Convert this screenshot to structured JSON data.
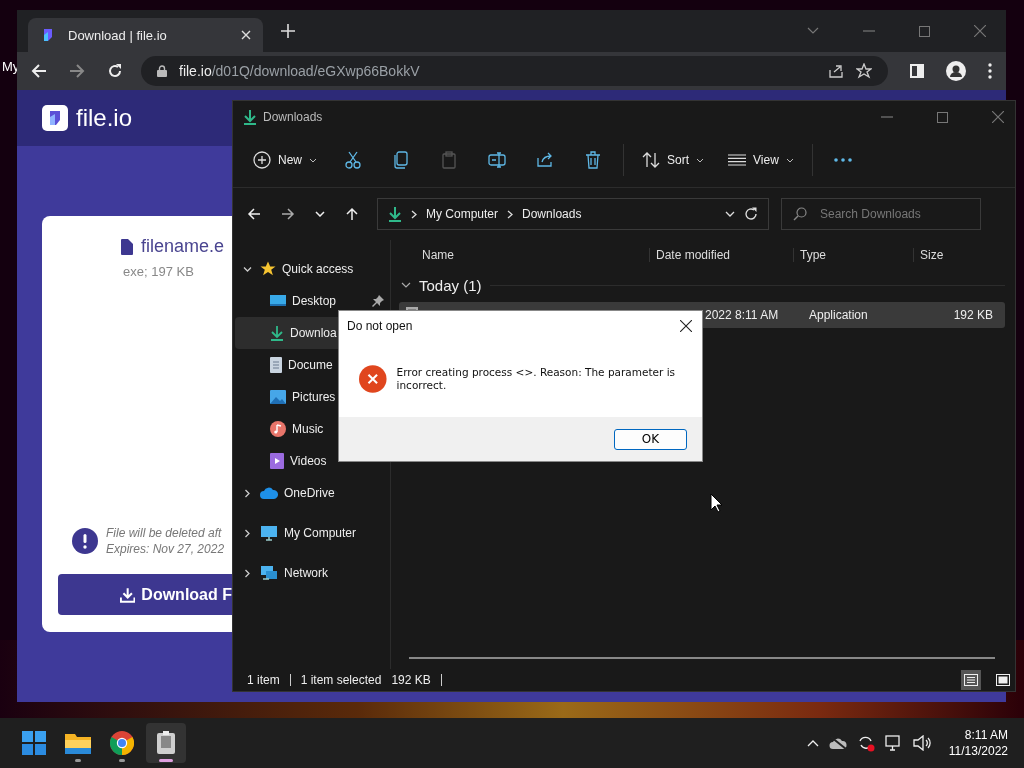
{
  "desktop": {
    "icon_label": "My"
  },
  "browser": {
    "tab": {
      "title": "Download | file.io",
      "selected": true
    },
    "url_host": "file.io",
    "url_path": "/d01Q/download/eGXwp66BokkV",
    "page": {
      "brand": "file.io",
      "file_name": "filename.e",
      "file_meta": "exe; 197 KB",
      "notice": "File will be deleted aft",
      "expires": "Expires: Nov 27, 2022",
      "download_button": "Download F"
    }
  },
  "explorer": {
    "title": "Downloads",
    "toolbar": [
      {
        "kind": "new",
        "label": "New",
        "disabled": false
      },
      {
        "kind": "cut",
        "disabled": false
      },
      {
        "kind": "copy",
        "disabled": false
      },
      {
        "kind": "paste",
        "disabled": true
      },
      {
        "kind": "rename",
        "disabled": false
      },
      {
        "kind": "share",
        "disabled": false
      },
      {
        "kind": "delete",
        "disabled": false
      },
      {
        "kind": "sort",
        "label": "Sort",
        "disabled": false
      },
      {
        "kind": "view",
        "label": "View",
        "disabled": false
      },
      {
        "kind": "more",
        "disabled": false
      }
    ],
    "breadcrumb": [
      "My Computer",
      "Downloads"
    ],
    "search": {
      "placeholder": "Search Downloads"
    },
    "sidebar": [
      {
        "kind": "star",
        "label": "Quick access",
        "expanded": true,
        "selected": false,
        "children": [
          {
            "kind": "desktop",
            "label": "Desktop",
            "pinned": true,
            "selected": false
          },
          {
            "kind": "download",
            "label": "Downloa",
            "pinned": false,
            "selected": true
          },
          {
            "kind": "document",
            "label": "Docume",
            "pinned": false,
            "selected": false
          },
          {
            "kind": "pictures",
            "label": "Pictures",
            "pinned": false,
            "selected": false
          },
          {
            "kind": "music",
            "label": "Music",
            "pinned": false,
            "selected": false
          },
          {
            "kind": "videos",
            "label": "Videos",
            "pinned": false,
            "selected": false
          }
        ]
      },
      {
        "kind": "cloud",
        "label": "OneDrive",
        "expanded": false,
        "selected": false
      },
      {
        "kind": "computer",
        "label": "My Computer",
        "expanded": false,
        "selected": false
      },
      {
        "kind": "network",
        "label": "Network",
        "expanded": false,
        "selected": false
      }
    ],
    "columns": [
      "Name",
      "Date modified",
      "Type",
      "Size"
    ],
    "group": "Today (1)",
    "rows": [
      {
        "date": "2022 8:11 AM",
        "type": "Application",
        "size": "192 KB",
        "selected": true
      }
    ],
    "status": {
      "count": "1 item",
      "selection": "1 item selected",
      "size": "192 KB"
    },
    "view_modes": [
      {
        "kind": "details",
        "selected": true
      },
      {
        "kind": "tiles",
        "selected": false
      }
    ]
  },
  "dialog": {
    "title": "Do not open",
    "message": "Error creating process <>.  Reason: The parameter is incorrect.",
    "button": "OK"
  },
  "taskbar": {
    "apps": [
      {
        "kind": "start",
        "running": false,
        "active": false
      },
      {
        "kind": "files",
        "running": true,
        "active": false
      },
      {
        "kind": "chrome",
        "running": true,
        "active": false
      },
      {
        "kind": "app",
        "running": true,
        "active": true
      }
    ],
    "clock": {
      "time": "8:11 AM",
      "date": "11/13/2022"
    }
  }
}
